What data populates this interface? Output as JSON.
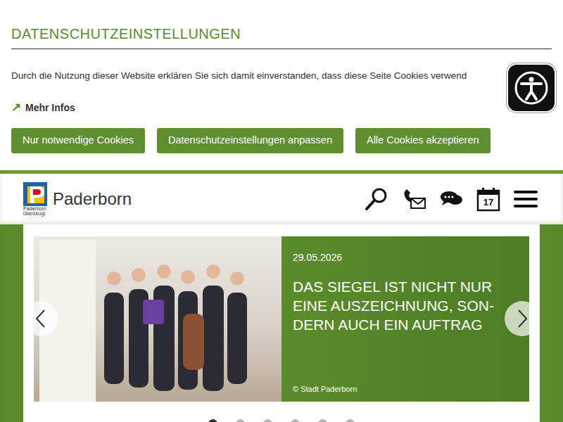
{
  "cookie_banner": {
    "title": "DATENSCHUTZEINSTELLUNGEN",
    "text": "Durch die Nutzung dieser Website erklären Sie sich damit einverstanden, dass diese Seite Cookies verwend",
    "more_link": {
      "icon": "↗",
      "label": "Mehr Infos"
    },
    "buttons": [
      "Nur notwendige Cookies",
      "Datenschutzeinstellungen anpassen",
      "Alle Cookies akzeptieren"
    ]
  },
  "header": {
    "logo": {
      "caption": [
        "Paderborn",
        "überzeugt."
      ]
    },
    "site_name": "Paderborn",
    "calendar_day": "17"
  },
  "slider": {
    "slide": {
      "date": "29.05.2026",
      "title": "DAS SIEGEL IST NICHT NUR EINE AUSZEICHNUNG, SON-DERN AUCH EIN AUFTRAG",
      "credit": "© Stadt Paderborn"
    },
    "dots": [
      {
        "selected": true
      },
      {
        "selected": false
      },
      {
        "selected": false
      },
      {
        "selected": false
      },
      {
        "selected": false
      },
      {
        "selected": false
      }
    ]
  }
}
